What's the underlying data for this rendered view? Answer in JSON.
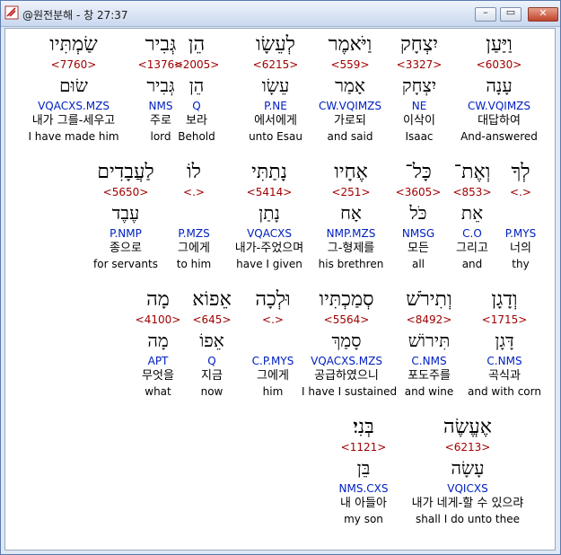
{
  "window": {
    "title": "@원전분해 - 창 27:37",
    "min_label": "–",
    "max_label": "▭",
    "close_label": "✕"
  },
  "rows": [
    [
      {
        "heb": "וַיַּעַן",
        "strong": "<6030>",
        "root": "עָנָה",
        "parse": "CW.VQIMZS",
        "kor": "대답하여",
        "eng": "And-answered"
      },
      {
        "heb": "יִצְחָק",
        "strong": "<3327>",
        "root": "יִצְחָק",
        "parse": "NE",
        "kor": "이삭이",
        "eng": "Isaac"
      },
      {
        "heb": "וַיֹּאמֶר",
        "strong": "<559>",
        "root": "אָמַר",
        "parse": "CW.VQIMZS",
        "kor": "가로되",
        "eng": "and said"
      },
      {
        "heb": "לְעֵשָׂו",
        "strong": "<6215>",
        "root": "עֵשָׂו",
        "parse": "P.NE",
        "kor": "에서에게",
        "eng": "unto Esau"
      },
      {
        "heb": "הֵן",
        "strong": "<2005>",
        "root": "הֵן",
        "parse": "Q",
        "kor": "보라",
        "eng": "Behold"
      },
      {
        "heb": "גְּבִיר",
        "strong": "<1376>",
        "root": "גְּבִיר",
        "parse": "NMS",
        "kor": "주로",
        "eng": "lord"
      },
      {
        "heb": "שַׂמְתִּיו",
        "strong": "<7760>",
        "root": "שׂוּם",
        "parse": "VQACXS.MZS",
        "kor": "내가 그를-세우고",
        "eng": "I have made him"
      }
    ],
    [
      {
        "heb": "לְךָ",
        "strong": "<.>",
        "root": "",
        "parse": "P.MYS",
        "kor": "너의",
        "eng": "thy"
      },
      {
        "heb": "וְאֶת־",
        "strong": "<853>",
        "root": "אֵת",
        "parse": "C.O",
        "kor": "그리고",
        "eng": "and"
      },
      {
        "heb": "כָּל־",
        "strong": "<3605>",
        "root": "כֹּל",
        "parse": "NMSG",
        "kor": "모든",
        "eng": "all"
      },
      {
        "heb": "אֶחָיו",
        "strong": "<251>",
        "root": "אָח",
        "parse": "NMP.MZS",
        "kor": "그-형제를",
        "eng": "his brethren"
      },
      {
        "heb": "נָתַתִּי",
        "strong": "<5414>",
        "root": "נָתַן",
        "parse": "VQACXS",
        "kor": "내가-주었으며",
        "eng": "have I given"
      },
      {
        "heb": "לוֹ",
        "strong": "<.>",
        "root": "",
        "parse": "P.MZS",
        "kor": "그에게",
        "eng": "to him"
      },
      {
        "heb": "לַעֲבָדִים",
        "strong": "<5650>",
        "root": "עֶבֶד",
        "parse": "P.NMP",
        "kor": "종으로",
        "eng": "for servants"
      }
    ],
    [
      {
        "heb": "וְדָגָן",
        "strong": "<1715>",
        "root": "דָּגָן",
        "parse": "C.NMS",
        "kor": "곡식과",
        "eng": "and with corn"
      },
      {
        "heb": "וְתִירֹשׁ",
        "strong": "<8492>",
        "root": "תִּירוֹשׁ",
        "parse": "C.NMS",
        "kor": "포도주를",
        "eng": "and wine"
      },
      {
        "heb": "סְמַכְתִּיו",
        "strong": "<5564>",
        "root": "סָמַךְ",
        "parse": "VQACXS.MZS",
        "kor": "공급하였으니",
        "eng": "I have I sustained"
      },
      {
        "heb": "וּלְכָה",
        "strong": "<.>",
        "root": "",
        "parse": "C.P.MYS",
        "kor": "그에게",
        "eng": "him"
      },
      {
        "heb": "אֵפוֹא",
        "strong": "<645>",
        "root": "אֵפוֹ",
        "parse": "Q",
        "kor": "지금",
        "eng": "now"
      },
      {
        "heb": "מָה",
        "strong": "<4100>",
        "root": "מָה",
        "parse": "APT",
        "kor": "무엇을",
        "eng": "what"
      }
    ],
    [
      {
        "heb": "אֶעֱשֶׂה",
        "strong": "<6213>",
        "root": "עָשָׂה",
        "parse": "VQICXS",
        "kor": "내가 네게-할 수 있으랴",
        "eng": "shall I do unto thee"
      },
      {
        "heb": "בְּנִי׃",
        "strong": "<1121>",
        "root": "בֵּן",
        "parse": "NMS.CXS",
        "kor": "내 아들아",
        "eng": "my son"
      }
    ]
  ]
}
